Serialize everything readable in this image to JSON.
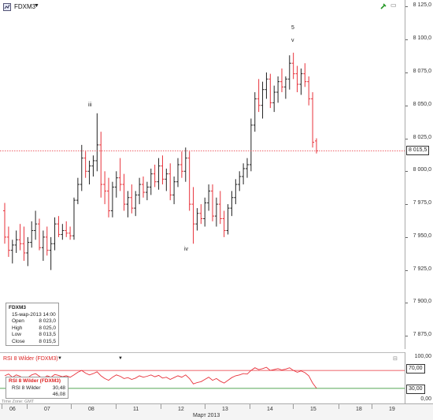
{
  "header": {
    "symbol": "FDXM3",
    "dropdown_icon": "chevron-down-icon",
    "toolbar_icon": "chart-type-icon",
    "pin_icon": "pin-icon"
  },
  "price_axis": {
    "ticks": [
      "8 125,0",
      "8 100,0",
      "8 075,0",
      "8 050,0",
      "8 025,0",
      "8 000,0",
      "7 975,0",
      "7 950,0",
      "7 925,0",
      "7 900,0",
      "7 875,0"
    ],
    "current_price": "8 015,5"
  },
  "wave_labels": [
    "iii",
    "iv",
    "5",
    "v"
  ],
  "ohlc": {
    "symbol": "FDXM3",
    "datetime": "15-мар-2013 14:00",
    "open_label": "Open",
    "open": "8 023,0",
    "high_label": "High",
    "high": "8 025,0",
    "low_label": "Low",
    "low": "8 013,5",
    "close_label": "Close",
    "close": "8 015,5"
  },
  "rsi": {
    "header": "RSI 8 Wilder (FDXM3)",
    "box_title": "RSI 8 Wilder (FDXM3)",
    "box_label": "RSI 8 Wilder",
    "value1": "30,48",
    "value2": "46,08",
    "axis_top": "100,00",
    "level_high": "70,00",
    "level_low": "30,00",
    "axis_bottom": "0,00",
    "timezone": "Time Zone: GMT",
    "upper_level": 70,
    "lower_level": 30
  },
  "time_axis": {
    "days": [
      "06",
      "07",
      "08",
      "11",
      "12",
      "13",
      "14",
      "15",
      "18",
      "19"
    ],
    "month": "Март 2013"
  },
  "colors": {
    "up": "#222222",
    "down": "#e8313a",
    "rsi_line": "#e8313a",
    "level_high": "#e8313a",
    "level_low": "#1e8a1e",
    "price_line": "#e8313a"
  },
  "chart_data": {
    "type": "bar",
    "y_range": [
      7865,
      8130
    ],
    "rsi_range": [
      0,
      100
    ],
    "current_price": 8015.5,
    "bars": [
      [
        7970,
        7976,
        7945,
        7950
      ],
      [
        7950,
        7958,
        7935,
        7940
      ],
      [
        7940,
        7948,
        7930,
        7944
      ],
      [
        7944,
        7955,
        7938,
        7948
      ],
      [
        7948,
        7960,
        7940,
        7945
      ],
      [
        7945,
        7958,
        7932,
        7938
      ],
      [
        7938,
        7950,
        7928,
        7946
      ],
      [
        7946,
        7962,
        7942,
        7955
      ],
      [
        7955,
        7970,
        7948,
        7960
      ],
      [
        7960,
        7964,
        7940,
        7942
      ],
      [
        7942,
        7955,
        7932,
        7950
      ],
      [
        7950,
        7958,
        7936,
        7940
      ],
      [
        7940,
        7950,
        7925,
        7945
      ],
      [
        7945,
        7965,
        7940,
        7960
      ],
      [
        7960,
        7966,
        7950,
        7952
      ],
      [
        7952,
        7960,
        7948,
        7955
      ],
      [
        7955,
        7962,
        7950,
        7953
      ],
      [
        7953,
        7958,
        7948,
        7951
      ],
      [
        7951,
        7980,
        7948,
        7978
      ],
      [
        7978,
        7995,
        7975,
        7990
      ],
      [
        7990,
        8020,
        7985,
        8010
      ],
      [
        8010,
        8015,
        7995,
        8000
      ],
      [
        8000,
        8008,
        7990,
        8004
      ],
      [
        8004,
        8012,
        7996,
        8008
      ],
      [
        8008,
        8044,
        8000,
        8020
      ],
      [
        8020,
        8030,
        7980,
        7990
      ],
      [
        7990,
        8000,
        7975,
        7985
      ],
      [
        7985,
        7995,
        7965,
        7970
      ],
      [
        7970,
        7992,
        7965,
        7988
      ],
      [
        7988,
        8000,
        7980,
        7995
      ],
      [
        7995,
        8010,
        7985,
        7990
      ],
      [
        7990,
        7998,
        7970,
        7975
      ],
      [
        7975,
        7985,
        7965,
        7980
      ],
      [
        7980,
        7990,
        7968,
        7972
      ],
      [
        7972,
        7985,
        7966,
        7982
      ],
      [
        7982,
        7995,
        7975,
        7990
      ],
      [
        7990,
        7996,
        7980,
        7984
      ],
      [
        7984,
        7992,
        7978,
        7988
      ],
      [
        7988,
        8002,
        7982,
        7998
      ],
      [
        7998,
        8005,
        7988,
        7992
      ],
      [
        7992,
        8010,
        7986,
        8004
      ],
      [
        8004,
        8012,
        7990,
        7994
      ],
      [
        7994,
        8002,
        7985,
        7998
      ],
      [
        7998,
        8006,
        7978,
        7982
      ],
      [
        7982,
        7996,
        7975,
        7992
      ],
      [
        7992,
        8010,
        7988,
        8005
      ],
      [
        8005,
        8015,
        7995,
        8000
      ],
      [
        8000,
        8018,
        7992,
        8010
      ],
      [
        8010,
        8015,
        7970,
        7975
      ],
      [
        7975,
        7988,
        7945,
        7960
      ],
      [
        7960,
        7972,
        7955,
        7968
      ],
      [
        7968,
        7975,
        7960,
        7964
      ],
      [
        7964,
        7980,
        7958,
        7976
      ],
      [
        7976,
        7990,
        7970,
        7985
      ],
      [
        7985,
        7990,
        7962,
        7966
      ],
      [
        7966,
        7980,
        7958,
        7975
      ],
      [
        7975,
        7985,
        7960,
        7964
      ],
      [
        7964,
        7970,
        7950,
        7955
      ],
      [
        7955,
        7975,
        7952,
        7972
      ],
      [
        7972,
        7985,
        7966,
        7980
      ],
      [
        7980,
        7994,
        7975,
        7990
      ],
      [
        7990,
        8000,
        7985,
        7996
      ],
      [
        7996,
        8006,
        7990,
        8002
      ],
      [
        8002,
        8010,
        7995,
        8005
      ],
      [
        8005,
        8040,
        8000,
        8035
      ],
      [
        8035,
        8060,
        8030,
        8055
      ],
      [
        8055,
        8070,
        8045,
        8050
      ],
      [
        8050,
        8068,
        8040,
        8062
      ],
      [
        8062,
        8075,
        8055,
        8070
      ],
      [
        8070,
        8074,
        8048,
        8052
      ],
      [
        8052,
        8065,
        8045,
        8060
      ],
      [
        8060,
        8072,
        8052,
        8068
      ],
      [
        8068,
        8078,
        8060,
        8064
      ],
      [
        8064,
        8072,
        8055,
        8070
      ],
      [
        8070,
        8088,
        8062,
        8082
      ],
      [
        8082,
        8090,
        8070,
        8074
      ],
      [
        8074,
        8080,
        8060,
        8066
      ],
      [
        8066,
        8078,
        8058,
        8074
      ],
      [
        8074,
        8082,
        8064,
        8068
      ],
      [
        8068,
        8072,
        8050,
        8055
      ],
      [
        8055,
        8060,
        8018,
        8022
      ],
      [
        8023,
        8025,
        8013.5,
        8015.5
      ]
    ],
    "rsi": [
      58,
      62,
      55,
      60,
      57,
      50,
      54,
      60,
      63,
      57,
      52,
      58,
      55,
      61,
      59,
      56,
      58,
      55,
      60,
      66,
      70,
      64,
      60,
      63,
      67,
      58,
      52,
      48,
      55,
      60,
      57,
      52,
      54,
      50,
      53,
      58,
      55,
      57,
      60,
      56,
      59,
      53,
      55,
      50,
      54,
      58,
      55,
      60,
      52,
      40,
      43,
      45,
      50,
      55,
      48,
      52,
      46,
      42,
      48,
      54,
      58,
      60,
      63,
      62,
      70,
      76,
      72,
      74,
      77,
      70,
      72,
      74,
      71,
      73,
      76,
      70,
      66,
      69,
      65,
      58,
      42,
      30.5
    ]
  }
}
